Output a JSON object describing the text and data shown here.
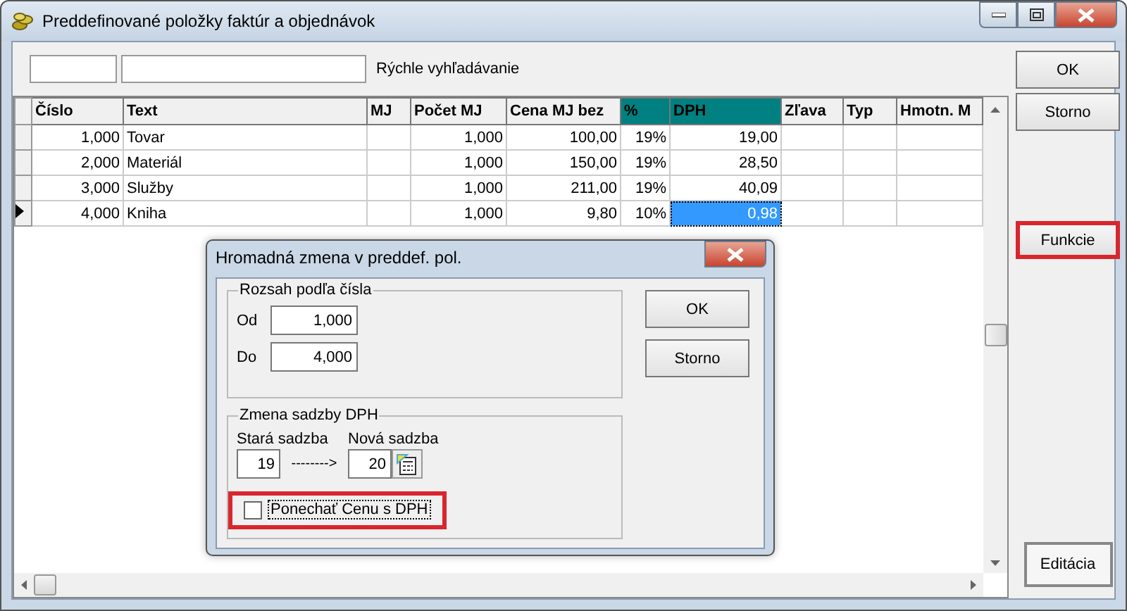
{
  "window": {
    "title": "Preddefinované položky faktúr a objednávok"
  },
  "search": {
    "label": "Rýchle vyhľadávanie"
  },
  "table": {
    "columns": [
      {
        "label": "Číslo",
        "selected": false
      },
      {
        "label": "Text",
        "selected": false
      },
      {
        "label": "MJ",
        "selected": false
      },
      {
        "label": "Počet MJ",
        "selected": false
      },
      {
        "label": "Cena MJ bez",
        "selected": false
      },
      {
        "label": "%",
        "selected": true
      },
      {
        "label": "DPH",
        "selected": true
      },
      {
        "label": "Zľava",
        "selected": false
      },
      {
        "label": "Typ",
        "selected": false
      },
      {
        "label": "Hmotn. M",
        "selected": false
      }
    ],
    "rows": [
      {
        "current": false,
        "cells": [
          {
            "text": "1,000",
            "selected": false
          },
          {
            "text": "Tovar",
            "selected": false
          },
          {
            "selected": false
          },
          {
            "text": "1,000",
            "selected": false
          },
          {
            "text": "100,00",
            "selected": false
          },
          {
            "text": "19%",
            "selected": false
          },
          {
            "text": "19,00",
            "selected": false
          },
          {
            "selected": false
          },
          {
            "selected": false
          },
          {
            "selected": false
          }
        ]
      },
      {
        "current": false,
        "cells": [
          {
            "text": "2,000",
            "selected": false
          },
          {
            "text": "Materiál",
            "selected": false
          },
          {
            "selected": false
          },
          {
            "text": "1,000",
            "selected": false
          },
          {
            "text": "150,00",
            "selected": false
          },
          {
            "text": "19%",
            "selected": false
          },
          {
            "text": "28,50",
            "selected": false
          },
          {
            "selected": false
          },
          {
            "selected": false
          },
          {
            "selected": false
          }
        ]
      },
      {
        "current": false,
        "cells": [
          {
            "text": "3,000",
            "selected": false
          },
          {
            "text": "Služby",
            "selected": false
          },
          {
            "selected": false
          },
          {
            "text": "1,000",
            "selected": false
          },
          {
            "text": "211,00",
            "selected": false
          },
          {
            "text": "19%",
            "selected": false
          },
          {
            "text": "40,09",
            "selected": false
          },
          {
            "selected": false
          },
          {
            "selected": false
          },
          {
            "selected": false
          }
        ]
      },
      {
        "current": true,
        "cells": [
          {
            "text": "4,000",
            "selected": false
          },
          {
            "text": "Kniha",
            "selected": false
          },
          {
            "selected": false
          },
          {
            "text": "1,000",
            "selected": false
          },
          {
            "text": "9,80",
            "selected": false
          },
          {
            "text": "10%",
            "selected": false
          },
          {
            "text": "0,98",
            "selected": true
          },
          {
            "selected": false
          },
          {
            "selected": false
          },
          {
            "selected": false
          }
        ]
      }
    ]
  },
  "side_buttons": {
    "top": [
      {
        "label": "OK",
        "highlighted": false
      },
      {
        "label": "Storno",
        "highlighted": false
      }
    ],
    "middle": [
      {
        "label": "Funkcie",
        "highlighted": true
      }
    ],
    "bottom": [
      {
        "label": "Editácia",
        "highlighted": false
      }
    ]
  },
  "dialog": {
    "title": "Hromadná zmena v preddef. pol.",
    "range": {
      "legend": "Rozsah podľa čísla",
      "from_label": "Od",
      "from_value": "1,000",
      "to_label": "Do",
      "to_value": "4,000"
    },
    "vat": {
      "legend": "Zmena sadzby DPH",
      "old_label": "Stará sadzba",
      "new_label": "Nová sadzba",
      "old_value": "19",
      "arrow": "-------->",
      "new_value": "20"
    },
    "keep_price": {
      "label": "Ponechať Cenu s DPH",
      "checked": false,
      "highlighted": true
    },
    "buttons": [
      "OK",
      "Storno"
    ]
  }
}
